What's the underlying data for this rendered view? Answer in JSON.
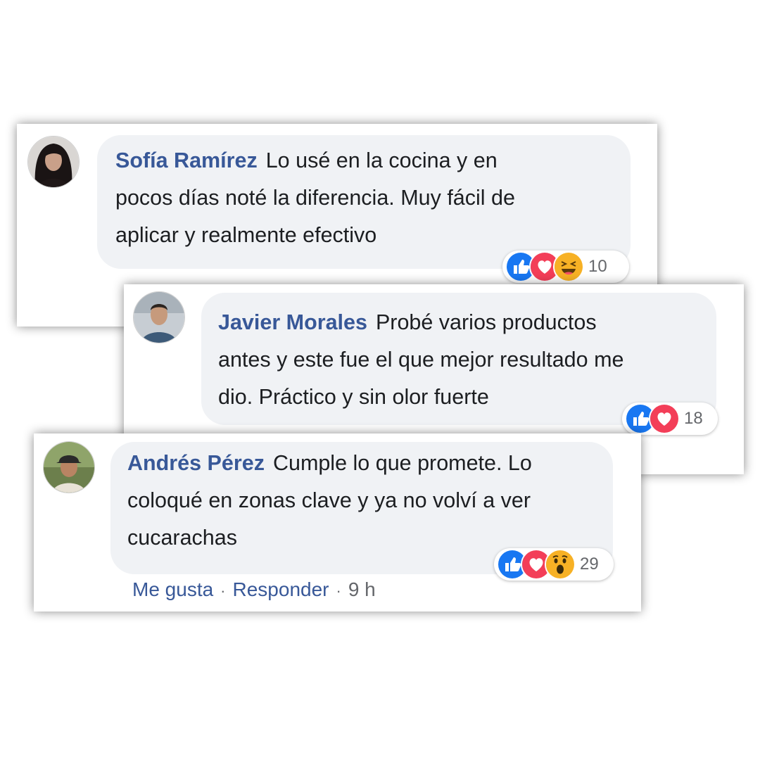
{
  "comments": [
    {
      "author": "Sofía Ramírez",
      "text": "Lo usé en la cocina y en pocos días noté la diferencia. Muy fácil de aplicar y realmente efectivo",
      "lines": [
        "Lo usé en la cocina y en",
        "pocos días noté la diferencia. Muy fácil de",
        "aplicar y realmente efectivo"
      ],
      "reactions": [
        "like-icon",
        "love-icon",
        "haha-icon"
      ],
      "reaction_count": "10"
    },
    {
      "author": "Javier Morales",
      "text": "Probé varios productos antes y este fue el que mejor resultado me dio. Práctico y sin olor fuerte",
      "lines": [
        "Probé varios productos",
        "antes y este fue el que mejor resultado me",
        "dio. Práctico y sin olor fuerte"
      ],
      "reactions": [
        "like-icon",
        "love-icon"
      ],
      "reaction_count": "18"
    },
    {
      "author": "Andrés Pérez",
      "text": "Cumple lo que promete. Lo coloqué en zonas clave y ya no volví a ver cucarachas",
      "lines": [
        "Cumple lo que promete. Lo",
        "coloqué en zonas clave y ya no volví a ver",
        "cucarachas"
      ],
      "reactions": [
        "like-icon",
        "love-icon",
        "wow-icon"
      ],
      "reaction_count": "29",
      "actions": {
        "like": "Me gusta",
        "reply": "Responder",
        "separator": "·",
        "time": "9 h"
      }
    }
  ],
  "colors": {
    "name": "#385898",
    "bubble": "#f0f2f5",
    "like": "#1877f2",
    "love": "#f33e58",
    "emoji": "#f7b125"
  }
}
